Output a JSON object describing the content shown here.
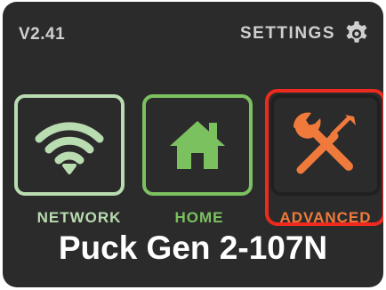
{
  "header": {
    "version": "V2.41",
    "settings_label": "SETTINGS",
    "settings_icon": "gear-icon"
  },
  "tiles": [
    {
      "id": "network",
      "label": "NETWORK",
      "icon": "wifi-icon",
      "color": "#b9dcb0"
    },
    {
      "id": "home",
      "label": "HOME",
      "icon": "home-icon",
      "color": "#7bc160"
    },
    {
      "id": "advanced",
      "label": "ADVANCED",
      "icon": "tools-icon",
      "color": "#f07a3c",
      "selected": true,
      "highlight_color": "#ee2a1e"
    }
  ],
  "device_name": "Puck Gen 2-107N",
  "colors": {
    "background": "#2b2b2b",
    "text_light": "#cfcfcf",
    "text_white": "#ffffff"
  }
}
